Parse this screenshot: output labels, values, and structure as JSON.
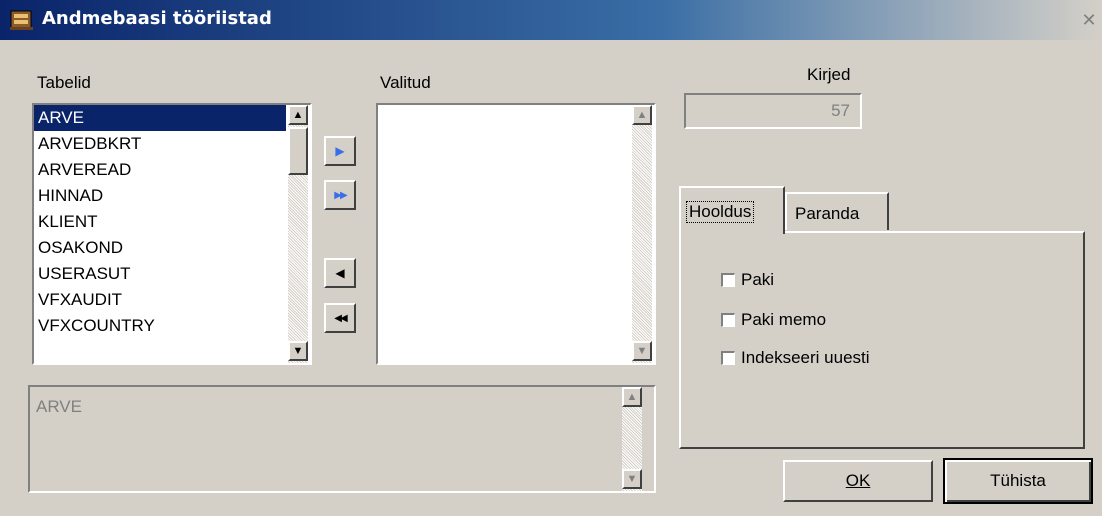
{
  "window": {
    "title": "Andmebaasi tööriistad",
    "close_glyph": "✕"
  },
  "tables": {
    "label": "Tabelid",
    "items": [
      "ARVE",
      "ARVEDBKRT",
      "ARVEREAD",
      "HINNAD",
      "KLIENT",
      "OSAKOND",
      "USERASUT",
      "VFXAUDIT",
      "VFXCOUNTRY"
    ],
    "selected": "ARVE"
  },
  "selected_list": {
    "label": "Valitud",
    "items": []
  },
  "move_buttons": {
    "add": "▶",
    "add_all": "▶▶",
    "remove": "◀",
    "remove_all": "◀◀"
  },
  "records": {
    "label": "Kirjed",
    "value": "57"
  },
  "description": {
    "value": "ARVE"
  },
  "tabs": [
    {
      "label": "Hooldus",
      "active": true
    },
    {
      "label": "Paranda",
      "active": false
    }
  ],
  "options": [
    {
      "label": "Paki",
      "checked": false
    },
    {
      "label": "Paki memo",
      "checked": false
    },
    {
      "label": "Indekseeri uuesti",
      "checked": false
    }
  ],
  "buttons": {
    "ok": "OK",
    "cancel": "Tühista"
  },
  "colors": {
    "selection": "#0a246a",
    "face": "#d4d0c8",
    "arrow_blue": "#3a6ee8"
  }
}
